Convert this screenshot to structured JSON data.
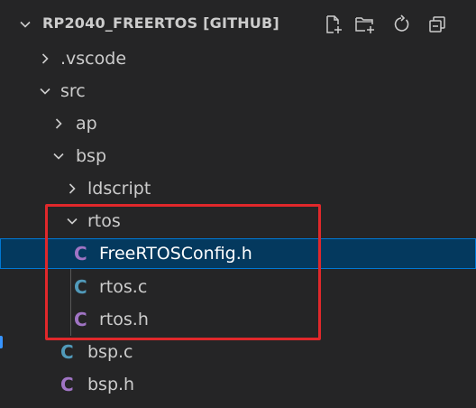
{
  "explorer": {
    "title": "RP2040_FREERTOS [GITHUB]",
    "actions": [
      "new-file-icon",
      "new-folder-icon",
      "refresh-icon",
      "collapse-all-icon"
    ]
  },
  "tree": [
    {
      "label": ".vscode",
      "kind": "folder",
      "expanded": false
    },
    {
      "label": "src",
      "kind": "folder",
      "expanded": true
    },
    {
      "label": "ap",
      "kind": "folder",
      "expanded": false
    },
    {
      "label": "bsp",
      "kind": "folder",
      "expanded": true
    },
    {
      "label": "ldscript",
      "kind": "folder",
      "expanded": false
    },
    {
      "label": "rtos",
      "kind": "folder",
      "expanded": true
    },
    {
      "label": "FreeRTOSConfig.h",
      "kind": "h-file",
      "icon_letter": "C",
      "selected": true
    },
    {
      "label": "rtos.c",
      "kind": "c-file",
      "icon_letter": "C"
    },
    {
      "label": "rtos.h",
      "kind": "h-file",
      "icon_letter": "C"
    },
    {
      "label": "bsp.c",
      "kind": "c-file",
      "icon_letter": "C"
    },
    {
      "label": "bsp.h",
      "kind": "h-file",
      "icon_letter": "C"
    }
  ],
  "colors": {
    "background": "#252526",
    "selection": "#04395e",
    "selection_border": "#0078d4",
    "c_file_icon": "#519aba",
    "h_file_icon": "#a074c4",
    "highlight": "#e0282b"
  }
}
